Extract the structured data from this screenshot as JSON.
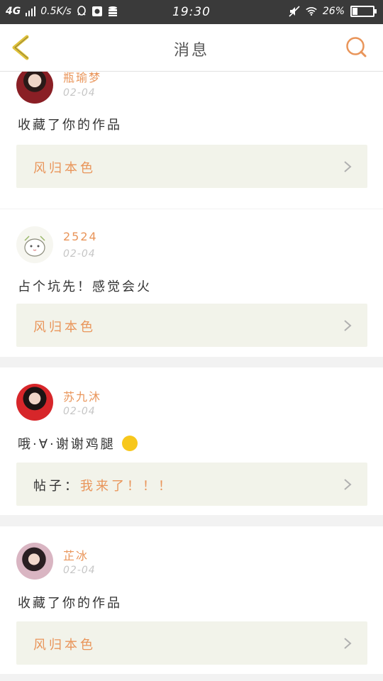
{
  "status_bar": {
    "network": "4G",
    "speed": "0.5K/s",
    "time": "19:30",
    "battery": "26%",
    "battery_level": 0.26
  },
  "header": {
    "title": "消息",
    "back_icon": "chevron-left-icon",
    "search_icon": "search-icon"
  },
  "colors": {
    "accent": "#e9955a",
    "back_arrow": "#e0c23a",
    "ref_background": "#f2f3ea"
  },
  "messages": [
    {
      "username": "瓶瑜梦",
      "date": "02-04",
      "text": "收藏了你的作品",
      "ref": {
        "prefix": "",
        "title": "风归本色"
      }
    },
    {
      "username": "2524",
      "date": "02-04",
      "text": "占个坑先！感觉会火",
      "ref": {
        "prefix": "",
        "title": "风归本色"
      }
    },
    {
      "username": "苏九沐",
      "date": "02-04",
      "text": "哦·∀·谢谢鸡腿",
      "ref": {
        "prefix": "帖子：",
        "title": "我来了！！！"
      }
    },
    {
      "username": "芷冰",
      "date": "02-04",
      "text": "收藏了你的作品",
      "ref": {
        "prefix": "",
        "title": "风归本色"
      }
    }
  ]
}
